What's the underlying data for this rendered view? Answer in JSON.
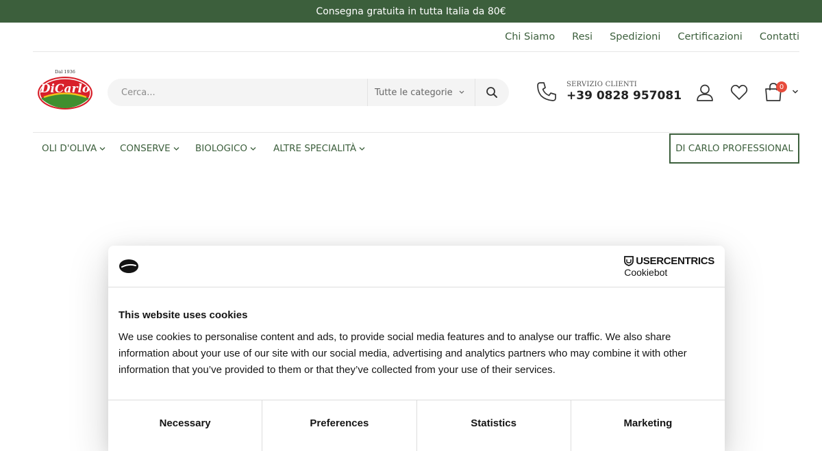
{
  "promo": {
    "text": "Consegna gratuita in tutta Italia da 80€"
  },
  "top_links": [
    "Chi Siamo",
    "Resi",
    "Spedizioni",
    "Certificazioni",
    "Contatti"
  ],
  "logo": {
    "text": "DiCarlo",
    "since": "Dal 1936"
  },
  "search": {
    "placeholder": "Cerca...",
    "category": "Tutte le categorie"
  },
  "service": {
    "label": "SERVIZIO CLIENTI",
    "phone": "+39 0828 957081"
  },
  "cart": {
    "count": "0"
  },
  "nav": {
    "items": [
      "OLI D'OLIVA",
      "CONSERVE",
      "BIOLOGICO",
      "ALTRE SPECIALITÀ"
    ],
    "pro_button": "DI CARLO PROFESSIONAL"
  },
  "cookie_dialog": {
    "brand_line1": "USERCENTRICS",
    "brand_line2": "Cookiebot",
    "title": "This website uses cookies",
    "body": "We use cookies to personalise content and ads, to provide social media features and to analyse our traffic. We also share information about your use of our site with our social media, advertising and analytics partners who may combine it with other information that you’ve provided to them or that they’ve collected from your use of their services.",
    "tabs": [
      "Necessary",
      "Preferences",
      "Statistics",
      "Marketing"
    ]
  },
  "colors": {
    "brand_green": "#3c5f3c",
    "badge_red": "#e74c3c",
    "logo_red": "#d8202a"
  }
}
